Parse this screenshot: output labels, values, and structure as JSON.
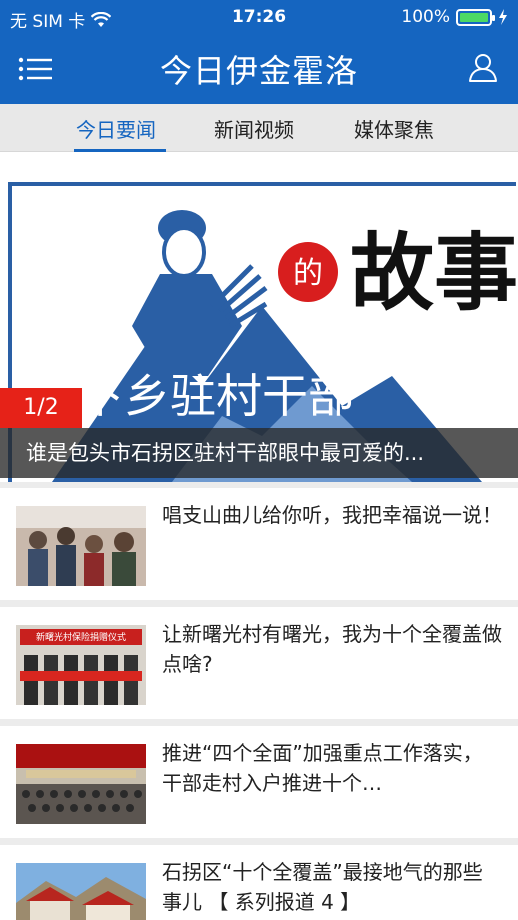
{
  "status_bar": {
    "carrier": "无 SIM 卡",
    "time": "17:26",
    "battery": "100%"
  },
  "header": {
    "title": "今日伊金霍洛"
  },
  "tabs": [
    {
      "label": "今日要闻"
    },
    {
      "label": "新闻视频"
    },
    {
      "label": "媒体聚焦"
    }
  ],
  "hero": {
    "counter": "1/2",
    "caption": "谁是包头市石拐区驻村干部眼中最可爱的...",
    "art_text": {
      "badge": "的",
      "main": "故事",
      "banner": "下乡驻村干部"
    }
  },
  "news": [
    {
      "headline": "唱支山曲儿给你听，我把幸福说一说！"
    },
    {
      "headline": "让新曙光村有曙光，我为十个全覆盖做点啥?"
    },
    {
      "headline": "推进“四个全面”加强重点工作落实，干部走村入户推进十个…"
    },
    {
      "headline": "石拐区“十个全覆盖”最接地气的那些事儿 【 系列报道 4 】"
    }
  ],
  "thumbs": [
    {
      "banner": ""
    },
    {
      "banner": "新曙光村保险捐赠仪式"
    },
    {
      "banner": ""
    },
    {
      "banner": ""
    }
  ],
  "colors": {
    "brand": "#1565c0",
    "accent_red": "#e62218",
    "tabs_bg": "#e8e8e8"
  }
}
